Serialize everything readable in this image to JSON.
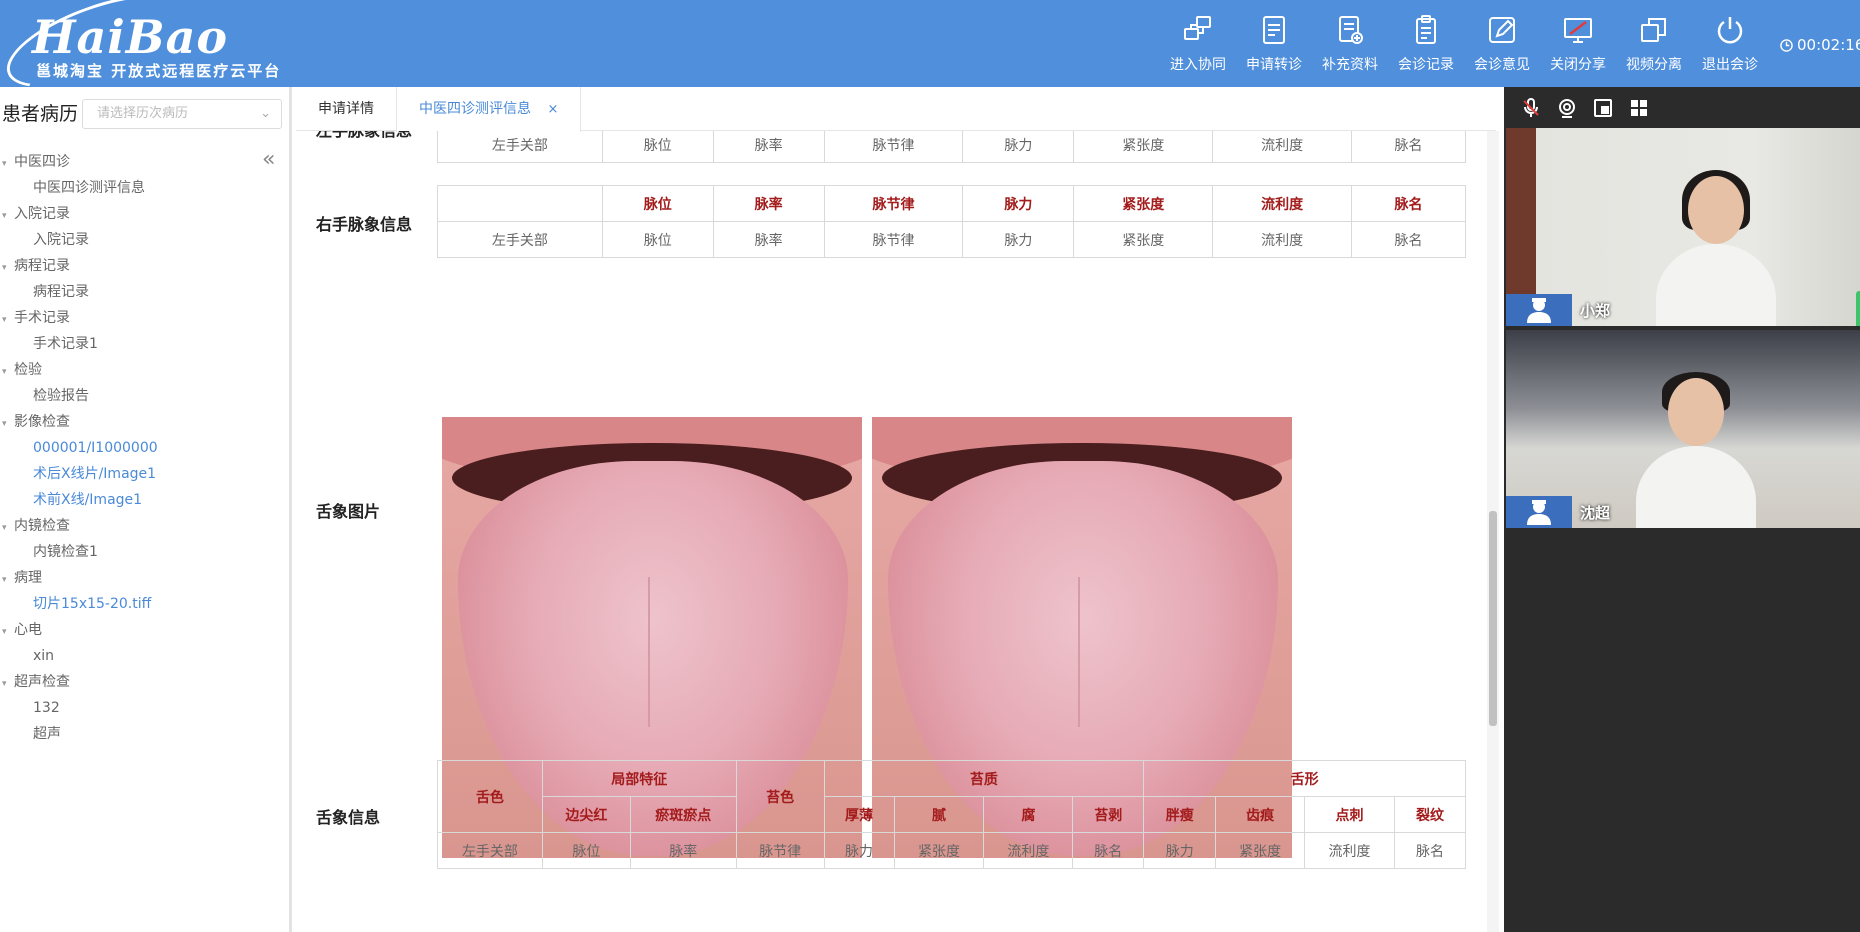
{
  "app": {
    "logo_text": "HaiBao",
    "logo_sub": "邕城淘宝 开放式远程医疗云平台"
  },
  "toolbar": [
    {
      "label": "进入协同",
      "icon": "collaborate-icon"
    },
    {
      "label": "申请转诊",
      "icon": "referral-icon"
    },
    {
      "label": "补充资料",
      "icon": "supplement-icon"
    },
    {
      "label": "会诊记录",
      "icon": "clipboard-icon"
    },
    {
      "label": "会诊意见",
      "icon": "edit-icon"
    },
    {
      "label": "关闭分享",
      "icon": "screen-share-off-icon"
    },
    {
      "label": "视频分离",
      "icon": "windows-icon"
    },
    {
      "label": "退出会诊",
      "icon": "power-icon"
    }
  ],
  "timer": "00:02:16",
  "sidebar": {
    "title": "患者病历",
    "select_placeholder": "请选择历次病历",
    "tree": [
      {
        "type": "cat",
        "label": "中医四诊"
      },
      {
        "type": "leaf",
        "label": "中医四诊测评信息"
      },
      {
        "type": "cat",
        "label": "入院记录"
      },
      {
        "type": "leaf",
        "label": "入院记录"
      },
      {
        "type": "cat",
        "label": "病程记录"
      },
      {
        "type": "leaf",
        "label": "病程记录"
      },
      {
        "type": "cat",
        "label": "手术记录"
      },
      {
        "type": "leaf",
        "label": "手术记录1"
      },
      {
        "type": "cat",
        "label": "检验"
      },
      {
        "type": "leaf",
        "label": "检验报告"
      },
      {
        "type": "cat",
        "label": "影像检查"
      },
      {
        "type": "link",
        "label": "000001/I1000000"
      },
      {
        "type": "link",
        "label": "术后X线片/Image1"
      },
      {
        "type": "link",
        "label": "术前X线/Image1"
      },
      {
        "type": "cat",
        "label": "内镜检查"
      },
      {
        "type": "leaf",
        "label": "内镜检查1"
      },
      {
        "type": "cat",
        "label": "病理"
      },
      {
        "type": "link",
        "label": "切片15x15-20.tiff"
      },
      {
        "type": "cat",
        "label": "心电"
      },
      {
        "type": "leaf",
        "label": "xin"
      },
      {
        "type": "cat",
        "label": "超声检查"
      },
      {
        "type": "leaf",
        "label": "132"
      },
      {
        "type": "leaf",
        "label": "超声"
      }
    ]
  },
  "tabs": {
    "detail": "申请详情",
    "tcm": "中医四诊测评信息",
    "close": "×"
  },
  "left_pulse": {
    "label": "左手脉象信息",
    "row": [
      "左手关部",
      "脉位",
      "脉率",
      "脉节律",
      "脉力",
      "紧张度",
      "流利度",
      "脉名"
    ]
  },
  "right_pulse": {
    "label": "右手脉象信息",
    "headers": [
      "",
      "脉位",
      "脉率",
      "脉节律",
      "脉力",
      "紧张度",
      "流利度",
      "脉名"
    ],
    "row": [
      "左手关部",
      "脉位",
      "脉率",
      "脉节律",
      "脉力",
      "紧张度",
      "流利度",
      "脉名"
    ]
  },
  "tongue_images": {
    "label": "舌象图片"
  },
  "tongue_info": {
    "label": "舌象信息",
    "h_color": "舌色",
    "h_local": "局部特征",
    "h_coating_color": "苔色",
    "h_coating": "苔质",
    "h_shape": "舌形",
    "sub_local": [
      "边尖红",
      "瘀斑瘀点"
    ],
    "sub_coating": [
      "厚薄",
      "腻",
      "腐",
      "苔剥"
    ],
    "sub_shape": [
      "胖瘦",
      "齿痕",
      "点刺",
      "裂纹"
    ],
    "row": [
      "左手关部",
      "脉位",
      "脉率",
      "脉节律",
      "脉力",
      "紧张度",
      "流利度",
      "脉名",
      "脉力",
      "紧张度",
      "流利度",
      "脉名"
    ]
  },
  "video": {
    "participants": [
      {
        "name": "小郑"
      },
      {
        "name": "沈超"
      }
    ]
  },
  "colors": {
    "header": "#4f8fdc",
    "accent": "#4a8ad8",
    "table_header": "#a31b1b"
  }
}
